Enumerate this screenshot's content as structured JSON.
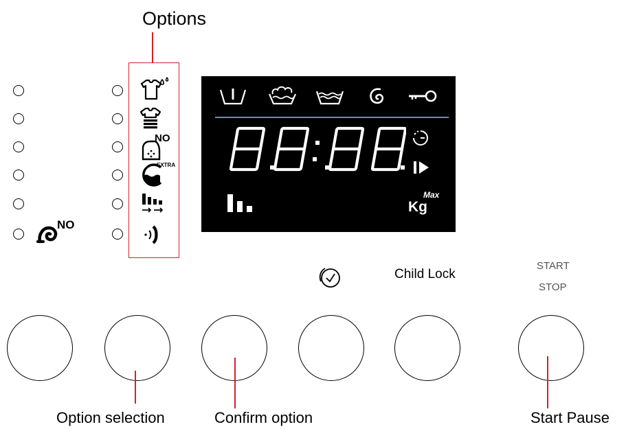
{
  "labels": {
    "options": "Options",
    "child_lock": "Child Lock",
    "start_line1": "START",
    "start_line2": "STOP",
    "option_selection": "Option selection",
    "confirm_option": "Confirm option",
    "start_pause": "Start Pause"
  },
  "display": {
    "digits": "8.8:8.8.",
    "icons": [
      "prewash-icon",
      "wash-icon",
      "rinse-icon",
      "spin-icon",
      "key-lock-icon",
      "timer-icon",
      "play-icon",
      "load-bars-icon"
    ],
    "kg_label": "Kg",
    "max_label": "Max"
  },
  "option_icons": {
    "no_label": "NO",
    "extra_label": "EXTRA"
  },
  "left_column": {
    "no_label": "NO"
  },
  "colors": {
    "accent_red": "#d32027",
    "display_bg": "#000000",
    "display_divider": "#6b8fb8",
    "display_fg": "#ffffff"
  }
}
